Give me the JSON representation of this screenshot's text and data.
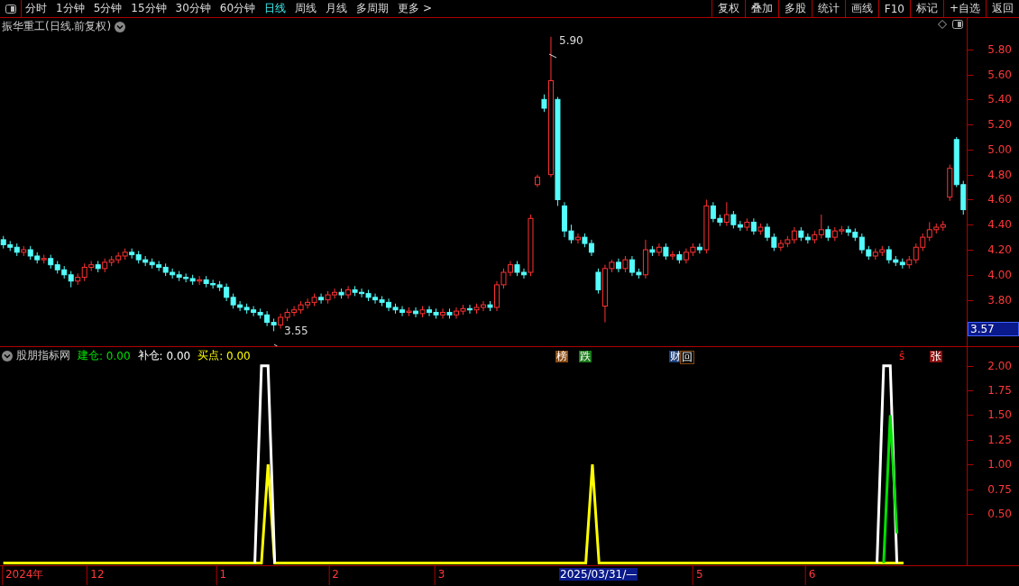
{
  "toolbar": {
    "periods": [
      {
        "label": "分时",
        "selected": false
      },
      {
        "label": "1分钟",
        "selected": false
      },
      {
        "label": "5分钟",
        "selected": false
      },
      {
        "label": "15分钟",
        "selected": false
      },
      {
        "label": "30分钟",
        "selected": false
      },
      {
        "label": "60分钟",
        "selected": false
      },
      {
        "label": "日线",
        "selected": true
      },
      {
        "label": "周线",
        "selected": false
      },
      {
        "label": "月线",
        "selected": false
      },
      {
        "label": "多周期",
        "selected": false
      },
      {
        "label": "更多 >",
        "selected": false
      }
    ],
    "actions": [
      "复权",
      "叠加",
      "多股",
      "统计",
      "画线",
      "F10",
      "标记",
      "+自选",
      "返回"
    ]
  },
  "price_panel": {
    "title": "振华重工(日线.前复权)",
    "current_price": "3.57",
    "high_label": "5.90",
    "low_label": "3.55",
    "chart_data": {
      "type": "candlestick",
      "ylim": [
        3.43,
        6.05
      ],
      "yticks": [
        {
          "value": 5.8,
          "label": "5.80"
        },
        {
          "value": 5.6,
          "label": "5.60"
        },
        {
          "value": 5.4,
          "label": "5.40"
        },
        {
          "value": 5.2,
          "label": "5.20"
        },
        {
          "value": 5,
          "label": "5.00"
        },
        {
          "value": 4.8,
          "label": "4.80"
        },
        {
          "value": 4.6,
          "label": "4.60"
        },
        {
          "value": 4.4,
          "label": "4.40"
        },
        {
          "value": 4.2,
          "label": "4.20"
        },
        {
          "value": 4,
          "label": "4.00"
        },
        {
          "value": 3.8,
          "label": "3.80"
        }
      ],
      "categories": [
        null,
        null,
        null,
        null,
        null,
        null,
        null,
        null,
        null,
        null,
        null,
        null,
        null,
        null,
        null,
        null,
        null,
        null,
        null,
        null,
        null,
        null,
        null,
        null,
        null,
        null,
        null,
        null,
        null,
        null,
        null,
        null,
        null,
        null,
        null,
        null,
        null,
        null,
        null,
        null,
        null,
        null,
        null,
        null,
        null,
        null,
        null,
        null,
        null,
        null,
        null,
        null,
        null,
        null,
        null,
        null,
        null,
        null,
        null,
        null,
        null,
        null,
        null,
        null,
        null,
        null,
        null,
        null,
        null,
        null,
        null,
        null,
        null,
        null,
        null,
        null,
        null,
        null,
        null,
        null,
        null,
        null,
        null,
        null,
        null,
        null,
        null,
        null,
        null,
        null,
        null,
        null,
        null,
        null,
        null,
        null,
        null,
        null,
        null,
        null,
        null,
        null,
        null,
        null,
        null,
        null,
        null,
        null,
        null,
        null,
        null,
        null,
        null,
        null,
        null,
        null,
        null,
        null,
        null,
        null,
        null,
        null,
        null,
        null,
        null,
        null,
        null,
        null,
        null,
        null,
        null,
        null,
        null,
        null,
        null,
        null,
        null,
        null,
        null,
        null,
        null,
        null,
        null
      ],
      "ohlc": [
        [
          4.28,
          4.31,
          4.21,
          4.24
        ],
        [
          4.24,
          4.27,
          4.19,
          4.22
        ],
        [
          4.22,
          4.25,
          4.15,
          4.18
        ],
        [
          4.18,
          4.23,
          4.15,
          4.2
        ],
        [
          4.2,
          4.23,
          4.12,
          4.15
        ],
        [
          4.15,
          4.18,
          4.09,
          4.12
        ],
        [
          4.12,
          4.16,
          4.09,
          4.13
        ],
        [
          4.13,
          4.16,
          4.05,
          4.08
        ],
        [
          4.08,
          4.11,
          4.01,
          4.04
        ],
        [
          4.04,
          4.07,
          3.97,
          4.0
        ],
        [
          4.0,
          4.03,
          3.9,
          3.95
        ],
        [
          3.95,
          4.01,
          3.92,
          3.98
        ],
        [
          3.98,
          4.09,
          3.95,
          4.06
        ],
        [
          4.06,
          4.11,
          4.03,
          4.08
        ],
        [
          4.08,
          4.11,
          4.02,
          4.05
        ],
        [
          4.05,
          4.13,
          4.02,
          4.1
        ],
        [
          4.1,
          4.15,
          4.07,
          4.12
        ],
        [
          4.12,
          4.18,
          4.09,
          4.15
        ],
        [
          4.15,
          4.21,
          4.12,
          4.18
        ],
        [
          4.18,
          4.21,
          4.13,
          4.16
        ],
        [
          4.16,
          4.19,
          4.09,
          4.12
        ],
        [
          4.12,
          4.15,
          4.07,
          4.1
        ],
        [
          4.1,
          4.13,
          4.05,
          4.08
        ],
        [
          4.08,
          4.11,
          4.03,
          4.06
        ],
        [
          4.06,
          4.09,
          3.99,
          4.02
        ],
        [
          4.02,
          4.05,
          3.97,
          4.0
        ],
        [
          4.0,
          4.03,
          3.95,
          3.98
        ],
        [
          3.98,
          4.01,
          3.94,
          3.97
        ],
        [
          3.97,
          4.0,
          3.92,
          3.95
        ],
        [
          3.95,
          3.99,
          3.92,
          3.96
        ],
        [
          3.96,
          3.99,
          3.9,
          3.93
        ],
        [
          3.93,
          3.96,
          3.89,
          3.92
        ],
        [
          3.92,
          3.95,
          3.87,
          3.9
        ],
        [
          3.9,
          3.93,
          3.79,
          3.82
        ],
        [
          3.82,
          3.85,
          3.73,
          3.76
        ],
        [
          3.76,
          3.79,
          3.71,
          3.74
        ],
        [
          3.74,
          3.77,
          3.69,
          3.72
        ],
        [
          3.72,
          3.75,
          3.67,
          3.7
        ],
        [
          3.7,
          3.73,
          3.65,
          3.68
        ],
        [
          3.68,
          3.71,
          3.59,
          3.62
        ],
        [
          3.62,
          3.65,
          3.55,
          3.6
        ],
        [
          3.6,
          3.69,
          3.57,
          3.66
        ],
        [
          3.66,
          3.73,
          3.63,
          3.7
        ],
        [
          3.7,
          3.75,
          3.67,
          3.72
        ],
        [
          3.72,
          3.79,
          3.69,
          3.76
        ],
        [
          3.76,
          3.81,
          3.73,
          3.78
        ],
        [
          3.78,
          3.85,
          3.75,
          3.82
        ],
        [
          3.82,
          3.85,
          3.77,
          3.8
        ],
        [
          3.8,
          3.87,
          3.77,
          3.84
        ],
        [
          3.84,
          3.89,
          3.81,
          3.86
        ],
        [
          3.86,
          3.89,
          3.81,
          3.84
        ],
        [
          3.84,
          3.91,
          3.81,
          3.88
        ],
        [
          3.88,
          3.91,
          3.83,
          3.86
        ],
        [
          3.86,
          3.89,
          3.82,
          3.85
        ],
        [
          3.85,
          3.88,
          3.79,
          3.82
        ],
        [
          3.82,
          3.85,
          3.77,
          3.8
        ],
        [
          3.8,
          3.83,
          3.75,
          3.78
        ],
        [
          3.78,
          3.81,
          3.71,
          3.74
        ],
        [
          3.74,
          3.77,
          3.69,
          3.72
        ],
        [
          3.72,
          3.75,
          3.67,
          3.7
        ],
        [
          3.7,
          3.74,
          3.67,
          3.71
        ],
        [
          3.71,
          3.74,
          3.66,
          3.69
        ],
        [
          3.69,
          3.75,
          3.66,
          3.72
        ],
        [
          3.72,
          3.75,
          3.67,
          3.7
        ],
        [
          3.7,
          3.73,
          3.65,
          3.68
        ],
        [
          3.68,
          3.73,
          3.65,
          3.7
        ],
        [
          3.7,
          3.73,
          3.65,
          3.68
        ],
        [
          3.68,
          3.74,
          3.65,
          3.71
        ],
        [
          3.71,
          3.76,
          3.68,
          3.73
        ],
        [
          3.73,
          3.76,
          3.69,
          3.72
        ],
        [
          3.72,
          3.77,
          3.69,
          3.74
        ],
        [
          3.74,
          3.79,
          3.71,
          3.76
        ],
        [
          3.76,
          3.79,
          3.71,
          3.74
        ],
        [
          3.74,
          3.95,
          3.71,
          3.92
        ],
        [
          3.92,
          4.05,
          3.89,
          4.02
        ],
        [
          4.02,
          4.11,
          3.99,
          4.08
        ],
        [
          4.08,
          4.11,
          3.99,
          4.02
        ],
        [
          4.02,
          4.05,
          3.97,
          4.0
        ],
        [
          4.02,
          4.48,
          3.99,
          4.45
        ],
        [
          4.72,
          4.8,
          4.7,
          4.78
        ],
        [
          5.4,
          5.44,
          5.3,
          5.33
        ],
        [
          4.8,
          5.9,
          4.78,
          5.55
        ],
        [
          5.4,
          5.42,
          4.55,
          4.6
        ],
        [
          4.55,
          4.58,
          4.3,
          4.35
        ],
        [
          4.35,
          4.4,
          4.25,
          4.28
        ],
        [
          4.28,
          4.33,
          4.25,
          4.3
        ],
        [
          4.3,
          4.33,
          4.22,
          4.25
        ],
        [
          4.25,
          4.28,
          4.15,
          4.18
        ],
        [
          4.02,
          4.05,
          3.85,
          3.88
        ],
        [
          3.75,
          4.08,
          3.62,
          4.05
        ],
        [
          4.05,
          4.12,
          4.02,
          4.1
        ],
        [
          4.1,
          4.13,
          4.02,
          4.05
        ],
        [
          4.05,
          4.15,
          4.02,
          4.12
        ],
        [
          4.12,
          4.15,
          3.99,
          4.02
        ],
        [
          4.02,
          4.05,
          3.97,
          4.0
        ],
        [
          4.0,
          4.28,
          3.97,
          4.2
        ],
        [
          4.2,
          4.23,
          4.15,
          4.18
        ],
        [
          4.18,
          4.25,
          4.15,
          4.22
        ],
        [
          4.22,
          4.25,
          4.12,
          4.15
        ],
        [
          4.15,
          4.19,
          4.12,
          4.16
        ],
        [
          4.16,
          4.19,
          4.09,
          4.12
        ],
        [
          4.12,
          4.21,
          4.09,
          4.18
        ],
        [
          4.18,
          4.25,
          4.15,
          4.22
        ],
        [
          4.22,
          4.25,
          4.17,
          4.2
        ],
        [
          4.2,
          4.6,
          4.17,
          4.55
        ],
        [
          4.55,
          4.58,
          4.42,
          4.45
        ],
        [
          4.45,
          4.48,
          4.39,
          4.42
        ],
        [
          4.42,
          4.58,
          4.39,
          4.48
        ],
        [
          4.48,
          4.51,
          4.37,
          4.4
        ],
        [
          4.4,
          4.43,
          4.35,
          4.38
        ],
        [
          4.38,
          4.45,
          4.35,
          4.42
        ],
        [
          4.42,
          4.45,
          4.32,
          4.35
        ],
        [
          4.35,
          4.41,
          4.32,
          4.38
        ],
        [
          4.38,
          4.41,
          4.27,
          4.3
        ],
        [
          4.3,
          4.33,
          4.19,
          4.22
        ],
        [
          4.22,
          4.28,
          4.19,
          4.25
        ],
        [
          4.25,
          4.31,
          4.22,
          4.28
        ],
        [
          4.28,
          4.38,
          4.25,
          4.35
        ],
        [
          4.35,
          4.38,
          4.27,
          4.3
        ],
        [
          4.3,
          4.33,
          4.25,
          4.28
        ],
        [
          4.28,
          4.35,
          4.25,
          4.32
        ],
        [
          4.32,
          4.48,
          4.29,
          4.36
        ],
        [
          4.36,
          4.39,
          4.27,
          4.3
        ],
        [
          4.3,
          4.38,
          4.27,
          4.35
        ],
        [
          4.35,
          4.39,
          4.32,
          4.36
        ],
        [
          4.36,
          4.39,
          4.31,
          4.34
        ],
        [
          4.34,
          4.37,
          4.27,
          4.3
        ],
        [
          4.3,
          4.33,
          4.17,
          4.2
        ],
        [
          4.2,
          4.23,
          4.12,
          4.15
        ],
        [
          4.15,
          4.21,
          4.12,
          4.18
        ],
        [
          4.18,
          4.23,
          4.15,
          4.2
        ],
        [
          4.2,
          4.23,
          4.09,
          4.12
        ],
        [
          4.12,
          4.15,
          4.07,
          4.1
        ],
        [
          4.1,
          4.13,
          4.05,
          4.08
        ],
        [
          4.08,
          4.15,
          4.05,
          4.12
        ],
        [
          4.12,
          4.25,
          4.09,
          4.22
        ],
        [
          4.22,
          4.33,
          4.19,
          4.3
        ],
        [
          4.3,
          4.42,
          4.27,
          4.36
        ],
        [
          4.36,
          4.41,
          4.33,
          4.38
        ],
        [
          4.38,
          4.43,
          4.35,
          4.4
        ],
        [
          4.62,
          4.88,
          4.59,
          4.85
        ],
        [
          5.08,
          5.1,
          4.7,
          4.72
        ],
        [
          4.72,
          4.75,
          4.48,
          4.52
        ]
      ]
    },
    "events": [
      {
        "label": "榜",
        "kind": "tag",
        "color": "#8b4a10"
      },
      {
        "label": "跌",
        "kind": "tag",
        "color": "#1a7a1a"
      },
      {
        "label": "财",
        "kind": "tag",
        "color": "#1c3f7a"
      },
      {
        "label": "回",
        "kind": "outline",
        "color": "#8b4a10"
      },
      {
        "label": "ŝ",
        "kind": "symbol",
        "color": "#ff2020"
      },
      {
        "label": "张",
        "kind": "tag",
        "color": "#8b1010"
      }
    ]
  },
  "indicator_panel": {
    "name": "股朋指标网",
    "legend_readings": [
      ": 0.00",
      ": 0.00",
      ": 0.00"
    ],
    "chart_data": {
      "type": "line",
      "ylim": [
        0,
        2.19
      ],
      "yticks": [
        {
          "value": 0.5,
          "label": "0.50"
        },
        {
          "value": 0.75,
          "label": "0.75"
        },
        {
          "value": 1,
          "label": "1.00"
        },
        {
          "value": 1.25,
          "label": "1.25"
        },
        {
          "value": 1.5,
          "label": "1.50"
        },
        {
          "value": 1.75,
          "label": "1.75"
        },
        {
          "value": 2,
          "label": "2.00"
        }
      ],
      "categories": [
        null,
        null,
        null,
        "2024年",
        null,
        null,
        null,
        null,
        null,
        null,
        null,
        null,
        null,
        null,
        "12",
        null,
        null,
        null,
        null,
        null,
        null,
        null,
        null,
        null,
        null,
        null,
        null,
        null,
        null,
        null,
        null,
        null,
        null,
        "1",
        null,
        null,
        null,
        null,
        null,
        null,
        null,
        null,
        null,
        null,
        null,
        null,
        null,
        null,
        null,
        null,
        "2",
        null,
        null,
        null,
        null,
        null,
        null,
        null,
        null,
        null,
        null,
        null,
        null,
        null,
        null,
        null,
        "3",
        null,
        null,
        null,
        null,
        null,
        null,
        null,
        null,
        null,
        null,
        null,
        null,
        null,
        null,
        null,
        null,
        null,
        null,
        null,
        null,
        null,
        null,
        null,
        null,
        null,
        null,
        null,
        null,
        null,
        null,
        null,
        null,
        null,
        null,
        null,
        null,
        null,
        null,
        "5",
        null,
        null,
        null,
        null,
        null,
        null,
        null,
        null,
        null,
        null,
        null,
        null,
        null,
        null,
        null,
        null,
        "6",
        null,
        null,
        null,
        null,
        null,
        null,
        null,
        null,
        null,
        null,
        null,
        null,
        null,
        null,
        null,
        null,
        null,
        null,
        null,
        null,
        null,
        null,
        null
      ],
      "series": [
        {
          "name": "建仓",
          "color": "#00e000",
          "values": [
            null,
            null,
            null,
            null,
            null,
            null,
            null,
            null,
            null,
            null,
            null,
            null,
            null,
            null,
            null,
            null,
            null,
            null,
            null,
            null,
            null,
            null,
            null,
            null,
            null,
            null,
            null,
            null,
            null,
            null,
            null,
            null,
            null,
            null,
            null,
            null,
            null,
            null,
            null,
            null,
            null,
            null,
            null,
            null,
            null,
            null,
            null,
            null,
            null,
            null,
            null,
            null,
            null,
            null,
            null,
            null,
            null,
            null,
            null,
            null,
            null,
            null,
            null,
            null,
            null,
            null,
            null,
            null,
            null,
            null,
            null,
            null,
            null,
            null,
            null,
            null,
            null,
            null,
            null,
            null,
            null,
            null,
            null,
            null,
            null,
            null,
            null,
            null,
            null,
            null,
            null,
            null,
            null,
            null,
            null,
            null,
            null,
            null,
            null,
            null,
            null,
            null,
            null,
            null,
            null,
            null,
            null,
            null,
            null,
            null,
            null,
            null,
            null,
            null,
            null,
            null,
            null,
            null,
            null,
            null,
            null,
            null,
            null,
            null,
            null,
            null,
            null,
            null,
            null,
            null,
            null,
            null,
            null,
            0,
            1.5,
            0.3,
            null,
            null,
            null,
            null,
            null,
            null,
            null,
            null,
            null,
            null
          ]
        },
        {
          "name": "补仓",
          "color": "#ffffff",
          "values": [
            null,
            null,
            null,
            null,
            null,
            null,
            null,
            null,
            null,
            null,
            null,
            null,
            null,
            null,
            null,
            null,
            null,
            null,
            null,
            null,
            null,
            null,
            null,
            null,
            null,
            null,
            null,
            null,
            null,
            null,
            null,
            null,
            null,
            null,
            null,
            null,
            null,
            null,
            0,
            2,
            2,
            0,
            null,
            null,
            null,
            null,
            null,
            null,
            null,
            null,
            null,
            null,
            null,
            null,
            null,
            null,
            null,
            null,
            null,
            null,
            null,
            null,
            null,
            null,
            null,
            null,
            null,
            null,
            null,
            null,
            null,
            null,
            null,
            null,
            null,
            null,
            null,
            null,
            null,
            null,
            null,
            null,
            null,
            null,
            null,
            null,
            null,
            null,
            null,
            null,
            null,
            null,
            null,
            null,
            null,
            null,
            null,
            null,
            null,
            null,
            null,
            null,
            null,
            null,
            null,
            null,
            null,
            null,
            null,
            null,
            null,
            null,
            null,
            null,
            null,
            null,
            null,
            null,
            null,
            null,
            null,
            null,
            null,
            null,
            null,
            null,
            null,
            null,
            null,
            null,
            null,
            null,
            0,
            2,
            2,
            0,
            null,
            null,
            null,
            null,
            null,
            null,
            null,
            null,
            null,
            null
          ]
        },
        {
          "name": "买点",
          "color": "#ffff00",
          "values": [
            0,
            0,
            0,
            0,
            0,
            0,
            0,
            0,
            0,
            0,
            0,
            0,
            0,
            0,
            0,
            0,
            0,
            0,
            0,
            0,
            0,
            0,
            0,
            0,
            0,
            0,
            0,
            0,
            0,
            0,
            0,
            0,
            0,
            0,
            0,
            0,
            0,
            0,
            0,
            0,
            1,
            0,
            0,
            0,
            0,
            0,
            0,
            0,
            0,
            0,
            0,
            0,
            0,
            0,
            0,
            0,
            0,
            0,
            0,
            0,
            0,
            0,
            0,
            0,
            0,
            0,
            0,
            0,
            0,
            0,
            0,
            0,
            0,
            0,
            0,
            0,
            0,
            0,
            0,
            0,
            0,
            0,
            0,
            0,
            0,
            0,
            0,
            0,
            0,
            1,
            0,
            0,
            0,
            0,
            0,
            0,
            0,
            0,
            0,
            0,
            0,
            0,
            0,
            0,
            0,
            0,
            0,
            0,
            0,
            0,
            0,
            0,
            0,
            0,
            0,
            0,
            0,
            0,
            0,
            0,
            0,
            0,
            0,
            0,
            0,
            0,
            0,
            0,
            0,
            0,
            0,
            0,
            0,
            0,
            0,
            0,
            0,
            null,
            null,
            null,
            null,
            null,
            null,
            null,
            null,
            null
          ]
        }
      ]
    }
  },
  "date_cursor": "2025/03/31/—"
}
